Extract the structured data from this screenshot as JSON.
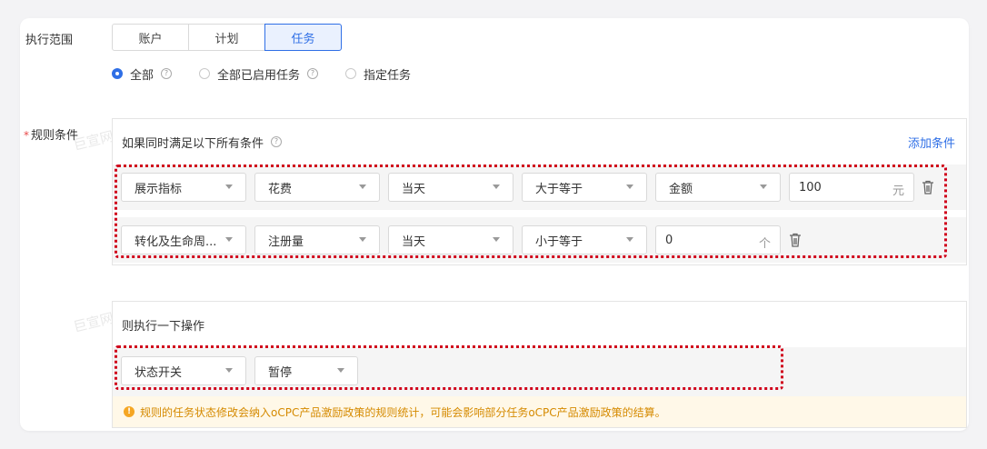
{
  "scope": {
    "label": "执行范围",
    "tabs": [
      "账户",
      "计划",
      "任务"
    ],
    "active_tab": "任务",
    "radios": [
      {
        "label": "全部",
        "checked": true
      },
      {
        "label": "全部已启用任务",
        "checked": false
      },
      {
        "label": "指定任务",
        "checked": false
      }
    ]
  },
  "rule": {
    "required_mark": "*",
    "label": "规则条件",
    "header": "如果同时满足以下所有条件",
    "add_condition": "添加条件",
    "conditions": [
      {
        "metric": "展示指标",
        "field": "花费",
        "period": "当天",
        "operator": "大于等于",
        "value_type": "金额",
        "value": "100",
        "unit": "元"
      },
      {
        "metric": "转化及生命周...",
        "field": "注册量",
        "period": "当天",
        "operator": "小于等于",
        "value": "0",
        "unit": "个"
      }
    ]
  },
  "action": {
    "header": "则执行一下操作",
    "type": "状态开关",
    "value": "暂停",
    "warning": "规则的任务状态修改会纳入oCPC产品激励政策的规则统计，可能会影响部分任务oCPC产品激励政策的结算。"
  },
  "watermark": "巨宣网络",
  "colors": {
    "accent": "#2f6fe6",
    "highlight_border": "#d0021b",
    "warning_text": "#d58a00",
    "warning_bg": "#fff8e8"
  }
}
